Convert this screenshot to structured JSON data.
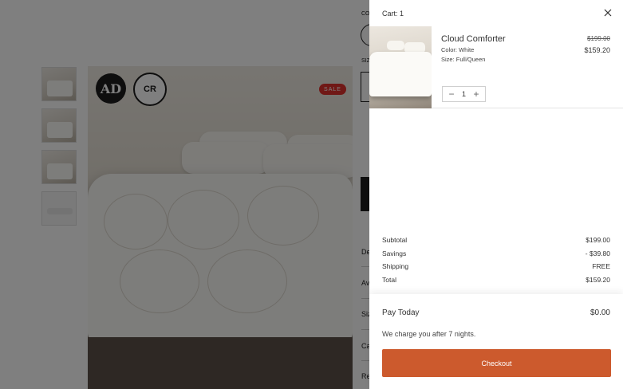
{
  "background": {
    "sale_badge": "SALE",
    "ad_badge": "AD",
    "cr_badge": "CR",
    "right_labels": [
      "CO",
      "SIZ",
      "De",
      "Av",
      "Siz",
      "Ca",
      "Re"
    ]
  },
  "cart": {
    "title": "Cart: 1",
    "item": {
      "name": "Cloud Comforter",
      "color": "Color: White",
      "size": "Size: Full/Queen",
      "price_old": "$199.00",
      "price_new": "$159.20",
      "quantity": "1",
      "minus": "−",
      "plus": "+"
    },
    "summary": [
      {
        "label": "Subtotal",
        "value": "$199.00"
      },
      {
        "label": "Savings",
        "value": "- $39.80"
      },
      {
        "label": "Shipping",
        "value": "FREE"
      },
      {
        "label": "Total",
        "value": "$159.20"
      }
    ],
    "pay_today_label": "Pay Today",
    "pay_today_amount": "$0.00",
    "charge_note": "We charge you after 7 nights.",
    "checkout_label": "Checkout"
  },
  "colors": {
    "checkout": "#cc5a2d",
    "sale": "#e0312d"
  }
}
